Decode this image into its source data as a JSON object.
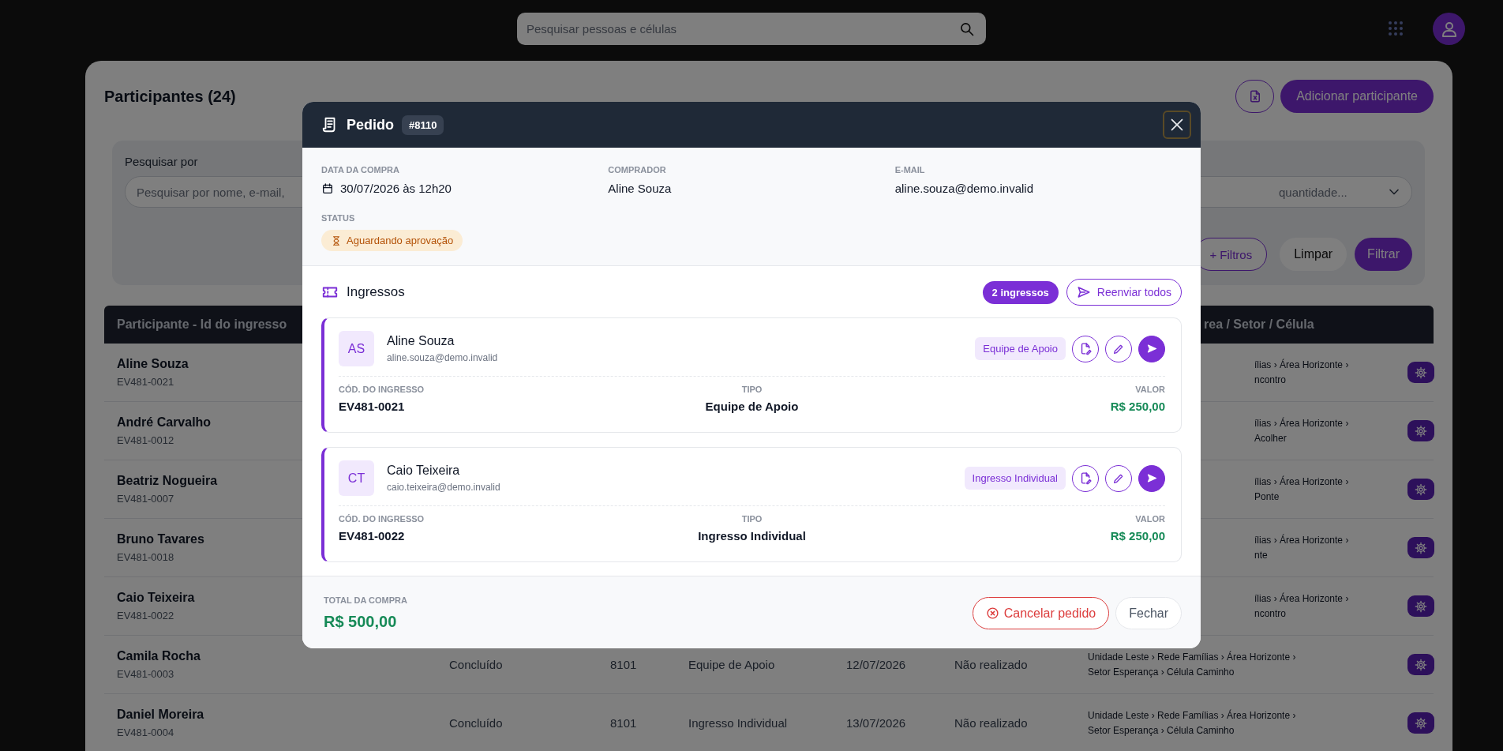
{
  "topbar": {
    "search": {
      "placeholder": "Pesquisar pessoas e células"
    }
  },
  "page": {
    "title": "Participantes (24)",
    "add_button": "Adicionar participante"
  },
  "filters": {
    "search_label": "Pesquisar por",
    "search_placeholder": "Pesquisar por nome, e-mail,",
    "quantity_placeholder": "quantidade...",
    "more_filters": "+ Filtros",
    "clear": "Limpar",
    "apply": "Filtrar"
  },
  "table": {
    "columns": [
      {
        "label": "Participante - Id do ingresso"
      },
      {
        "label": "rea / Setor / Célula"
      }
    ],
    "rows": [
      {
        "kind": "covered",
        "name": "Aline Souza",
        "ticket_id": "EV481-0021",
        "area_line_1": "ílias › Área Horizonte ›",
        "area_line_2": "ncontro"
      },
      {
        "kind": "covered",
        "name": "André Carvalho",
        "ticket_id": "EV481-0012",
        "area_line_1": "ílias › Área Horizonte ›",
        "area_line_2": "Acolher"
      },
      {
        "kind": "covered",
        "name": "Beatriz Nogueira",
        "ticket_id": "EV481-0007",
        "area_line_1": "ílias › Área Horizonte ›",
        "area_line_2": "Ponte"
      },
      {
        "kind": "covered",
        "name": "Bruno Tavares",
        "ticket_id": "EV481-0018",
        "area_line_1": "ílias › Área Horizonte ›",
        "area_line_2": "nte"
      },
      {
        "kind": "covered",
        "name": "Caio Teixeira",
        "ticket_id": "EV481-0022",
        "area_line_1": "ílias › Área Horizonte ›",
        "area_line_2": "ncontro"
      },
      {
        "kind": "full",
        "name": "Camila Rocha",
        "ticket_id": "EV481-0003",
        "status": "Concluído",
        "order": "8101",
        "type": "Equipe de Apoio",
        "date": "12/07/2026",
        "checkin": "Não realizado",
        "area_line_1": "Unidade Leste › Rede Famílias › Área Horizonte ›",
        "area_line_2": "Setor Esperança › Célula Caminho"
      },
      {
        "kind": "full",
        "name": "Daniel Moreira",
        "ticket_id": "EV481-0004",
        "status": "Concluído",
        "order": "8101",
        "type": "Ingresso Individual",
        "date": "13/07/2026",
        "checkin": "Não realizado",
        "area_line_1": "Unidade Leste › Rede Famílias › Área Horizonte ›",
        "area_line_2": "Setor Esperança › Célula Caminho"
      }
    ]
  },
  "modal": {
    "title": "Pedido",
    "order_number": "#8110",
    "fields": [
      {
        "kind": "date",
        "label": "DATA DA COMPRA",
        "value": "30/07/2026 às 12h20"
      },
      {
        "kind": "text",
        "label": "COMPRADOR",
        "value": "Aline Souza"
      },
      {
        "kind": "text",
        "label": "E-MAIL",
        "value": "aline.souza@demo.invalid"
      }
    ],
    "status": {
      "label": "STATUS",
      "kind": "pending",
      "value": "Aguardando aprovação"
    },
    "tickets_section": {
      "title": "Ingressos",
      "count": "2 ingressos",
      "resend_all": "Reenviar todos"
    },
    "tickets": [
      {
        "initials": "AS",
        "name": "Aline Souza",
        "email": "aline.souza@demo.invalid",
        "tag": "Equipe de Apoio",
        "code_label": "CÓD. DO INGRESSO",
        "code": "EV481-0021",
        "type_label": "TIPO",
        "type": "Equipe de Apoio",
        "value_label": "VALOR",
        "value": "R$ 250,00"
      },
      {
        "initials": "CT",
        "name": "Caio Teixeira",
        "email": "caio.teixeira@demo.invalid",
        "tag": "Ingresso Individual",
        "code_label": "CÓD. DO INGRESSO",
        "code": "EV481-0022",
        "type_label": "TIPO",
        "type": "Ingresso Individual",
        "value_label": "VALOR",
        "value": "R$ 250,00"
      }
    ],
    "footer": {
      "total_label": "TOTAL DA COMPRA",
      "total": "R$ 500,00",
      "cancel": "Cancelar pedido",
      "close": "Fechar"
    }
  }
}
